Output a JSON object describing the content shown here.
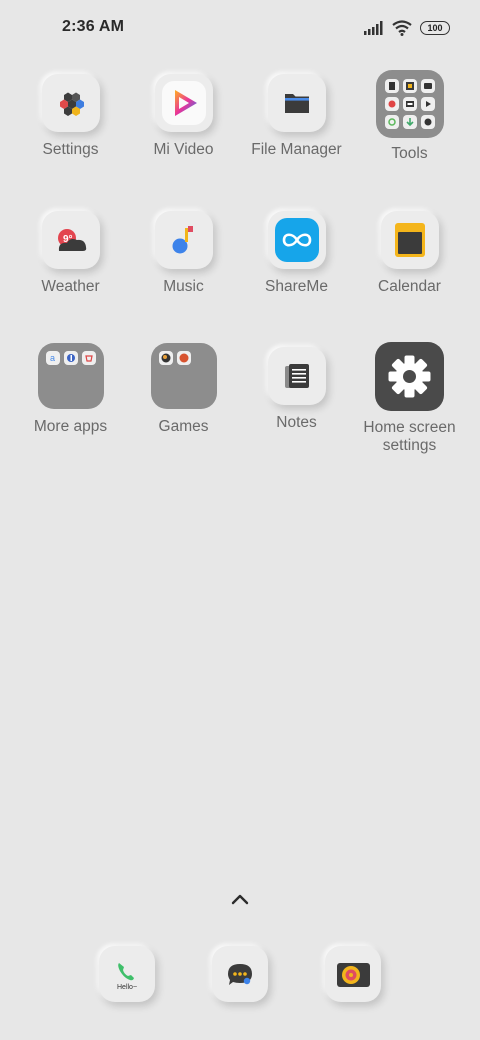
{
  "status": {
    "time": "2:36 AM",
    "battery": "100"
  },
  "apps": {
    "settings": "Settings",
    "mi_video": "Mi Video",
    "file_manager": "File Manager",
    "tools": "Tools",
    "weather": "Weather",
    "music": "Music",
    "shareme": "ShareMe",
    "calendar": "Calendar",
    "more_apps": "More apps",
    "games": "Games",
    "notes": "Notes",
    "home_screen_settings": "Home screen settings"
  },
  "weather_icon_temp": "9°",
  "dock": {
    "phone_caption": "Hello~"
  }
}
